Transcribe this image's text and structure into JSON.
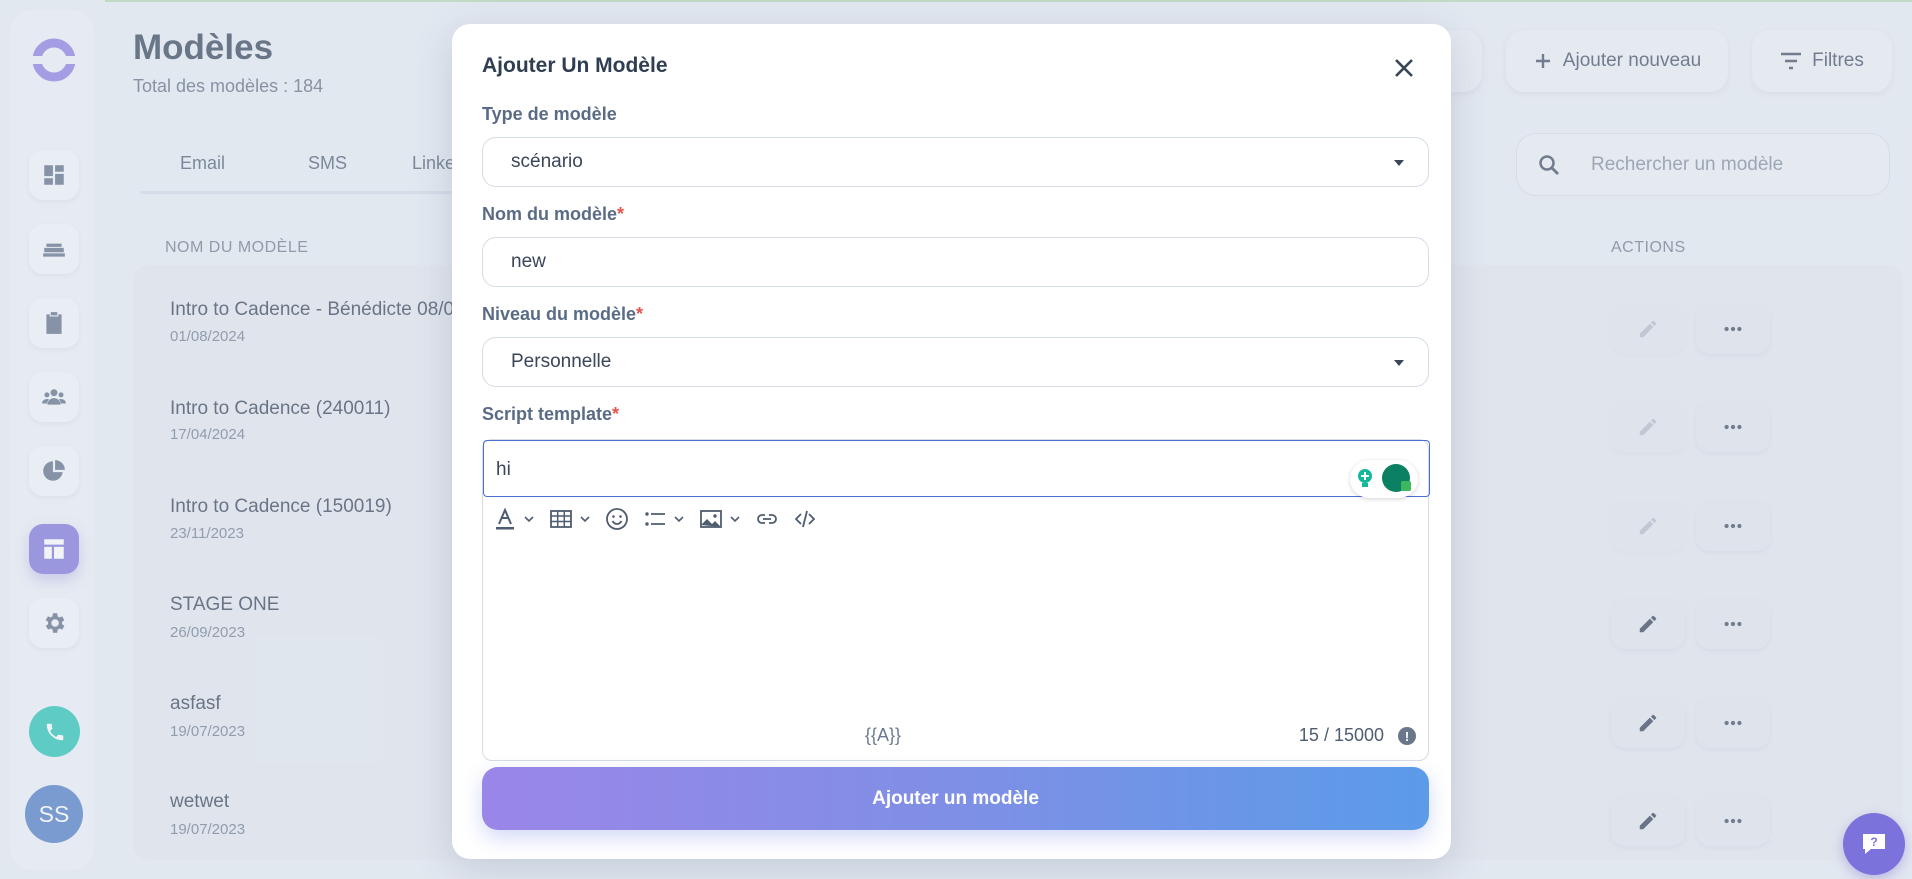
{
  "page": {
    "title": "Modèles",
    "subtitle": "Total des modèles : 184",
    "tabs": [
      "Email",
      "SMS",
      "Linke"
    ],
    "add_new_label": "Ajouter nouveau",
    "filters_label": "Filtres",
    "search_placeholder": "Rechercher un modèle",
    "col_name": "NOM DU MODÈLE",
    "col_actions": "ACTIONS",
    "rows": [
      {
        "name": "Intro to Cadence - Bénédicte 08/0",
        "date": "01/08/2024"
      },
      {
        "name": "Intro to Cadence (240011)",
        "date": "17/04/2024"
      },
      {
        "name": "Intro to Cadence (150019)",
        "date": "23/11/2023"
      },
      {
        "name": "STAGE ONE",
        "date": "26/09/2023"
      },
      {
        "name": "asfasf",
        "date": "19/07/2023"
      },
      {
        "name": "wetwet",
        "date": "19/07/2023"
      }
    ]
  },
  "user": {
    "initials": "SS"
  },
  "modal": {
    "title": "Ajouter Un Modèle",
    "type_label": "Type de modèle",
    "type_value": "scénario",
    "name_label": "Nom du modèle",
    "name_value": "new",
    "level_label": "Niveau du modèle",
    "level_value": "Personnelle",
    "script_label": "Script template",
    "required_mark": "*",
    "editor_text": "hi",
    "variable_hint": "{{A}}",
    "char_counter": "15 / 15000",
    "info_mark": "!",
    "submit_label": "Ajouter un modèle"
  },
  "colors": {
    "accent": "#7b72db",
    "call": "#1ec4b3",
    "avatar": "#4879c4",
    "required": "#e5534b"
  }
}
